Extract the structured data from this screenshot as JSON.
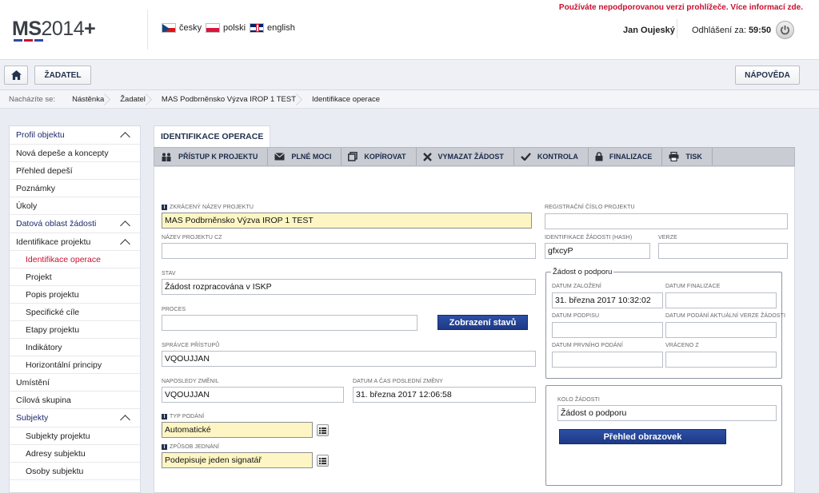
{
  "header": {
    "logo_bold": "MS",
    "logo_thin": "2014",
    "logo_plus": "+",
    "logo_bar_colors": [
      "#2f4aa0",
      "#c8102e",
      "#2f4aa0"
    ],
    "languages": [
      {
        "label": "česky",
        "flag": "cz-flag-icon"
      },
      {
        "label": "polski",
        "flag": "pl-flag-icon"
      },
      {
        "label": "english",
        "flag": "uk-flag-icon"
      }
    ],
    "unsupported_notice": "Používáte nepodporovanou verzi prohlížeče. Více informací zde.",
    "user_name": "Jan Oujeský",
    "logout_label": "Odhlášení za:",
    "logout_timer": "59:50"
  },
  "toolbar": {
    "zadatel_label": "ŽADATEL",
    "napoveda_label": "NÁPOVĚDA"
  },
  "breadcrumb": {
    "label": "Nacházíte se:",
    "items": [
      "Nástěnka",
      "Žadatel",
      "MAS Podbrněnsko Výzva IROP 1 TEST",
      "Identifikace operace"
    ]
  },
  "sidebar": {
    "items": [
      {
        "label": "Profil objektu",
        "type": "head"
      },
      {
        "label": "Nová depeše a koncepty",
        "type": "item"
      },
      {
        "label": "Přehled depeší",
        "type": "item"
      },
      {
        "label": "Poznámky",
        "type": "item"
      },
      {
        "label": "Úkoly",
        "type": "item"
      },
      {
        "label": "Datová oblast žádosti",
        "type": "head"
      },
      {
        "label": "Identifikace projektu",
        "type": "head"
      },
      {
        "label": "Identifikace operace",
        "type": "sub-active"
      },
      {
        "label": "Projekt",
        "type": "sub"
      },
      {
        "label": "Popis projektu",
        "type": "sub"
      },
      {
        "label": "Specifické cíle",
        "type": "sub"
      },
      {
        "label": "Etapy projektu",
        "type": "sub"
      },
      {
        "label": "Indikátory",
        "type": "sub"
      },
      {
        "label": "Horizontální principy",
        "type": "sub"
      },
      {
        "label": "Umístění",
        "type": "item"
      },
      {
        "label": "Cílová skupina",
        "type": "item"
      },
      {
        "label": "Subjekty",
        "type": "head"
      },
      {
        "label": "Subjekty projektu",
        "type": "sub"
      },
      {
        "label": "Adresy subjektu",
        "type": "sub"
      },
      {
        "label": "Osoby subjektu",
        "type": "sub"
      }
    ]
  },
  "main": {
    "tab_label": "IDENTIFIKACE OPERACE",
    "actions": [
      {
        "label": "PŘÍSTUP K PROJEKTU",
        "icon": "users-icon"
      },
      {
        "label": "PLNÉ MOCI",
        "icon": "envelope-icon"
      },
      {
        "label": "KOPÍROVAT",
        "icon": "copy-icon"
      },
      {
        "label": "VYMAZAT ŽÁDOST",
        "icon": "delete-x-icon"
      },
      {
        "label": "KONTROLA",
        "icon": "checkmark-icon"
      },
      {
        "label": "FINALIZACE",
        "icon": "lock-icon"
      },
      {
        "label": "TISK",
        "icon": "printer-icon"
      }
    ]
  },
  "form": {
    "zkraceny_nazev_label": "ZKRÁCENÝ NÁZEV PROJEKTU",
    "zkraceny_nazev_value": "MAS Podbrněnsko Výzva IROP 1 TEST",
    "nazev_cz_label": "NÁZEV PROJEKTU CZ",
    "nazev_cz_value": "",
    "stav_label": "STAV",
    "stav_value": "Žádost rozpracována v ISKP",
    "proces_label": "PROCES",
    "proces_value": "",
    "zobrazeni_stavu_button": "Zobrazení stavů",
    "spravce_label": "SPRÁVCE PŘÍSTUPŮ",
    "spravce_value": "VQOUJJAN",
    "naposledy_label": "NAPOSLEDY ZMĚNIL",
    "naposledy_value": "VQOUJJAN",
    "datum_zmeny_label": "DATUM A ČAS POSLEDNÍ ZMĚNY",
    "datum_zmeny_value": "31. března 2017 12:06:58",
    "typ_podani_label": "TYP PODÁNÍ",
    "typ_podani_value": "Automatické",
    "zpusob_label": "ZPŮSOB JEDNÁNÍ",
    "zpusob_value": "Podepisuje jeden signatář",
    "registracni_label": "REGISTRAČNÍ ČÍSLO PROJEKTU",
    "registracni_value": "",
    "hash_label": "IDENTIFIKACE ŽÁDOSTI (HASH)",
    "hash_value": "gfxcyP",
    "verze_label": "VERZE",
    "verze_value": "",
    "podpora_legend": "Žádost o podporu",
    "datum_zalozeni_label": "DATUM ZALOŽENÍ",
    "datum_zalozeni_value": "31. března 2017 10:32:02",
    "datum_finalizace_label": "DATUM FINALIZACE",
    "datum_finalizace_value": "",
    "datum_podpisu_label": "DATUM PODPISU",
    "datum_podpisu_value": "",
    "datum_podani_verze_label": "DATUM PODÁNÍ AKTUÁLNÍ VERZE ŽÁDOSTI",
    "datum_podani_verze_value": "",
    "datum_prvniho_label": "DATUM PRVNÍHO PODÁNÍ",
    "datum_prvniho_value": "",
    "vraceno_label": "VRÁCENO Z",
    "vraceno_value": "",
    "kolo_label": "KOLO ŽÁDOSTI",
    "kolo_value": "Žádost o podporu",
    "prehled_button": "Přehled obrazovek"
  }
}
